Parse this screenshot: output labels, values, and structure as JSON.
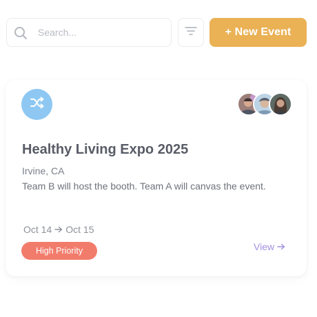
{
  "toolbar": {
    "search_placeholder": "Search...",
    "new_event_label": "+ New Event",
    "new_event_color": "#eab155"
  },
  "event_card": {
    "type_icon": "shuffle-icon",
    "type_icon_bg": "#8ec8f2",
    "attendees": [
      {
        "name": "attendee-1-avatar"
      },
      {
        "name": "attendee-2-avatar"
      },
      {
        "name": "attendee-3-avatar"
      }
    ],
    "title": "Healthy Living Expo 2025",
    "location": "Irvine, CA",
    "description": "Team B will host the booth. Team A will canvas the event.",
    "date_start": "Oct 14",
    "date_end": "Oct 15",
    "priority_label": "High Priority",
    "priority_color": "#f27c6c",
    "view_label": "View"
  }
}
